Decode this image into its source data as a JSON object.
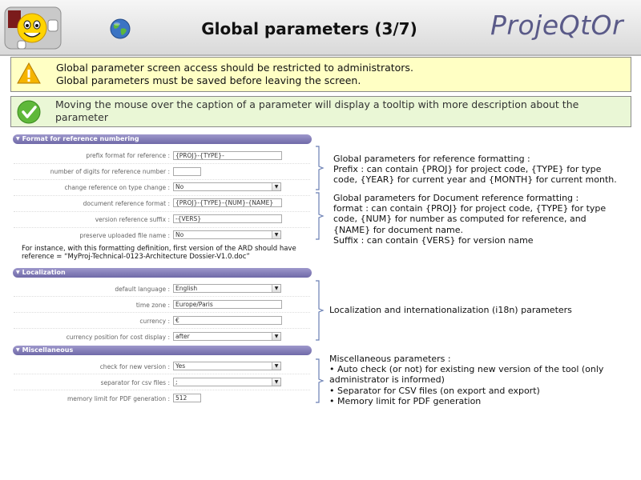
{
  "header": {
    "title": "Global parameters (3/7)",
    "brand": "ProjeQtOr"
  },
  "messages": {
    "warning_lines": [
      "Global parameter screen access should be restricted to administrators.",
      "Global parameters must be saved before leaving the screen."
    ],
    "tip": "Moving the mouse over the caption of a parameter will display a tooltip with more description about the parameter"
  },
  "sections": {
    "reference": {
      "title": "Format for reference numbering",
      "rows": [
        {
          "label": "prefix format for reference :",
          "value": "{PROJ}-{TYPE}-",
          "type": "text"
        },
        {
          "label": "number of digits for reference number :",
          "value": "",
          "type": "text"
        },
        {
          "label": "change reference on type change :",
          "value": "No",
          "type": "select"
        },
        {
          "label": "document reference format :",
          "value": "{PROJ}-{TYPE}-{NUM}-{NAME}",
          "type": "text"
        },
        {
          "label": "version reference suffix :",
          "value": "-{VERS}",
          "type": "text"
        },
        {
          "label": "preserve uploaded file name :",
          "value": "No",
          "type": "select"
        }
      ],
      "example_line1": "For instance, with this formatting definition, first version of the ARD should have",
      "example_line2": "reference = “MyProj-Technical-0123-Architecture Dossier-V1.0.doc”"
    },
    "localization": {
      "title": "Localization",
      "rows": [
        {
          "label": "default language :",
          "value": "English",
          "type": "select"
        },
        {
          "label": "time zone :",
          "value": "Europe/Paris",
          "type": "text"
        },
        {
          "label": "currency :",
          "value": "€",
          "type": "text"
        },
        {
          "label": "currency position for cost display :",
          "value": "after",
          "type": "select"
        }
      ]
    },
    "misc": {
      "title": "Miscellaneous",
      "rows": [
        {
          "label": "check for new version :",
          "value": "Yes",
          "type": "select"
        },
        {
          "label": "separator for csv files :",
          "value": ";",
          "type": "select"
        },
        {
          "label": "memory limit for PDF generation :",
          "value": "512",
          "type": "text"
        }
      ]
    }
  },
  "descriptions": {
    "reference_formatting": [
      "Global parameters for reference formatting :",
      "Prefix : can contain {PROJ} for project code, {TYPE} for type",
      "code, {YEAR} for current year and {MONTH} for current month."
    ],
    "document_formatting": [
      "Global parameters for Document reference formatting :",
      "format : can contain {PROJ} for project code, {TYPE} for type",
      "code, {NUM} for number as computed for reference, and",
      "{NAME} for document name.",
      "Suffix : can contain {VERS} for version name"
    ],
    "localization": "Localization and internationalization (i18n) parameters",
    "misc": [
      "Miscellaneous parameters :",
      "• Auto check (or not) for existing new version of the tool (only",
      "administrator is informed)",
      "• Separator for CSV files (on export and export)",
      "• Memory limit for PDF generation"
    ]
  },
  "colors": {
    "section_header": "#7a74b2",
    "warning_bg": "#ffffc4",
    "tip_bg": "#eaf7d6",
    "brand": "#5a5a88"
  }
}
